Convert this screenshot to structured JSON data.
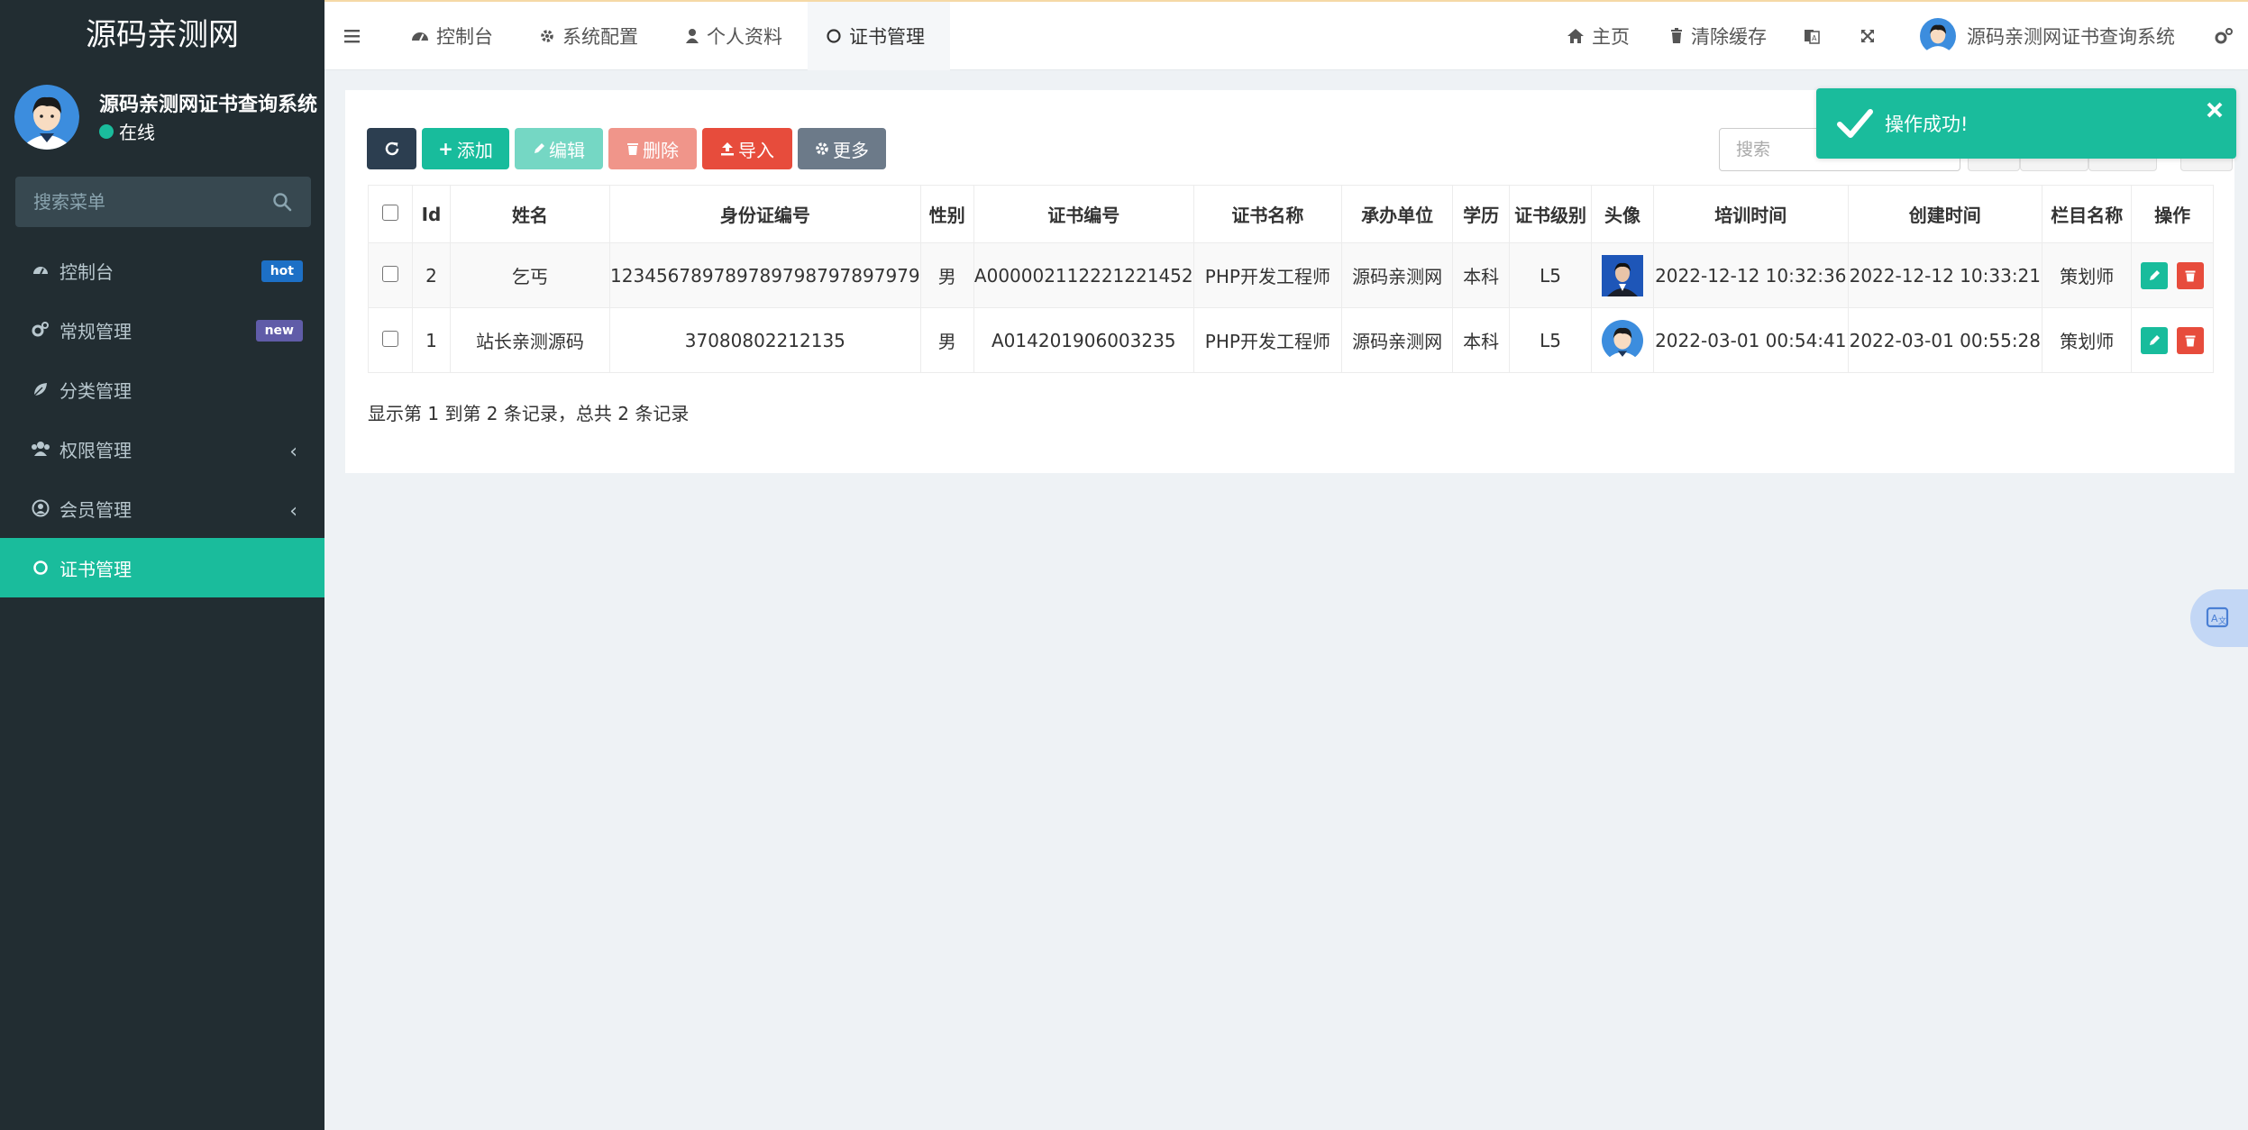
{
  "sidebar": {
    "brand": "源码亲测网",
    "user_name": "源码亲测网证书查询系统",
    "user_status": "在线",
    "search_placeholder": "搜索菜单",
    "items": [
      {
        "label": "控制台",
        "icon": "dashboard-icon",
        "badge": "hot"
      },
      {
        "label": "常规管理",
        "icon": "cogs-icon",
        "badge": "new"
      },
      {
        "label": "分类管理",
        "icon": "leaf-icon"
      },
      {
        "label": "权限管理",
        "icon": "group-icon"
      },
      {
        "label": "会员管理",
        "icon": "user-circle-icon"
      },
      {
        "label": "证书管理",
        "icon": "circle-icon"
      }
    ]
  },
  "topnav": {
    "tabs": [
      {
        "label": "控制台",
        "icon": "dashboard-icon"
      },
      {
        "label": "系统配置",
        "icon": "gear-icon"
      },
      {
        "label": "个人资料",
        "icon": "user-icon"
      },
      {
        "label": "证书管理",
        "icon": "circle-icon"
      }
    ],
    "home_label": "主页",
    "clear_cache_label": "清除缓存",
    "admin_name": "源码亲测网证书查询系统"
  },
  "toolbar": {
    "refresh": "",
    "add": "添加",
    "edit": "编辑",
    "delete": "删除",
    "import": "导入",
    "more": "更多",
    "search_placeholder": "搜索"
  },
  "table": {
    "headers": [
      "Id",
      "姓名",
      "身份证编号",
      "性别",
      "证书编号",
      "证书名称",
      "承办单位",
      "学历",
      "证书级别",
      "头像",
      "培训时间",
      "创建时间",
      "栏目名称",
      "操作"
    ],
    "rows": [
      {
        "id": "2",
        "name": "乞丐",
        "idcard": "12345678978978979879789797​9",
        "gender": "男",
        "cert_no": "A000002112221221452",
        "cert_name": "PHP开发工程师",
        "org": "源码亲测网",
        "edu": "本科",
        "level": "L5",
        "train_time": "2022-12-12 10:32:36",
        "create_time": "2022-12-12 10:33:21",
        "column": "策划师"
      },
      {
        "id": "1",
        "name": "站长亲测源码",
        "idcard": "37080802212135",
        "gender": "男",
        "cert_no": "A014201906003235",
        "cert_name": "PHP开发工程师",
        "org": "源码亲测网",
        "edu": "本科",
        "level": "L5",
        "train_time": "2022-03-01 00:54:41",
        "create_time": "2022-03-01 00:55:28",
        "column": "策划师"
      }
    ],
    "page_info": "显示第 1 到第 2 条记录，总共 2 条记录"
  },
  "toast": {
    "message": "操作成功!"
  },
  "colors": {
    "sidebar": "#222d32",
    "accent": "#1abc9c",
    "danger": "#e74c3c"
  }
}
